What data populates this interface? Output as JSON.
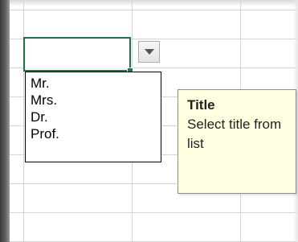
{
  "dropdown": {
    "items": [
      "Mr.",
      "Mrs.",
      "Dr.",
      "Prof."
    ]
  },
  "tooltip": {
    "title": "Title",
    "body": "Select title from list"
  },
  "colors": {
    "active_cell_border": "#217346",
    "tooltip_background": "#ffffe1",
    "gridline": "#d4d4d4"
  },
  "icons": {
    "dropdown_arrow": "chevron-down-icon"
  }
}
